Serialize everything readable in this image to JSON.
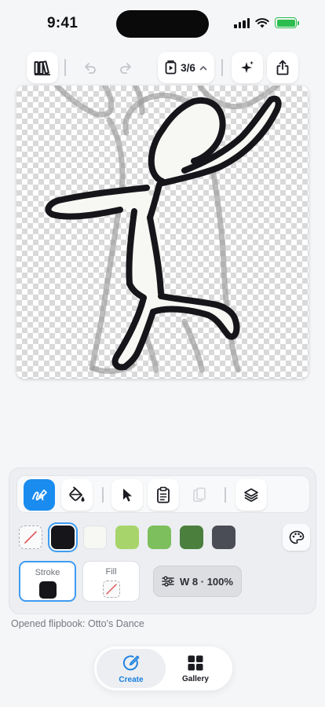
{
  "status_bar": {
    "time": "9:41",
    "signal_icon": "cellular-signal-icon",
    "wifi_icon": "wifi-icon",
    "battery_icon": "battery-charging-icon",
    "battery_color": "#2dbd4e"
  },
  "toolbar": {
    "library_icon": "library-books-icon",
    "undo_icon": "undo-icon",
    "redo_icon": "redo-icon",
    "frame_icon": "flipbook-frame-icon",
    "frame_counter": "3/6",
    "frame_chevron_icon": "chevron-up-icon",
    "sparkle_icon": "sparkle-icon",
    "share_icon": "share-icon"
  },
  "canvas": {
    "background": "transparent-checkerboard",
    "onion_skin_color": "#9a9a9a",
    "stroke_color": "#15151a",
    "fill_color": "#f7f7f3"
  },
  "tools": {
    "items": [
      {
        "name": "pen-tool",
        "icon": "pen-scribble-icon",
        "active": true
      },
      {
        "name": "fill-bucket-tool",
        "icon": "paint-bucket-icon",
        "active": false
      },
      {
        "name": "select-tool",
        "icon": "cursor-arrow-icon",
        "active": false
      },
      {
        "name": "copy-frame",
        "icon": "clipboard-icon",
        "active": false
      },
      {
        "name": "paste-frame",
        "icon": "paste-icon",
        "active": false,
        "disabled": true
      },
      {
        "name": "layers",
        "icon": "layers-icon",
        "active": false
      }
    ],
    "active_color": "#1a8cf0"
  },
  "swatches": {
    "colors": [
      "none",
      "#15151a",
      "#f7f7f3",
      "#a8d56b",
      "#7dbf5c",
      "#4a7f3e",
      "#4a4d55"
    ],
    "selected": "#15151a",
    "palette_icon": "palette-icon"
  },
  "stroke_fill": {
    "stroke_label": "Stroke",
    "stroke_color": "#15151a",
    "fill_label": "Fill",
    "fill_color": "none",
    "width_icon": "sliders-icon",
    "width_label": "W 8 · 100%"
  },
  "status_message": "Opened flipbook: Otto's Dance",
  "bottom_nav": {
    "items": [
      {
        "label": "Create",
        "icon": "create-pencil-circle-icon",
        "active": true
      },
      {
        "label": "Gallery",
        "icon": "gallery-grid-icon",
        "active": false
      }
    ]
  }
}
